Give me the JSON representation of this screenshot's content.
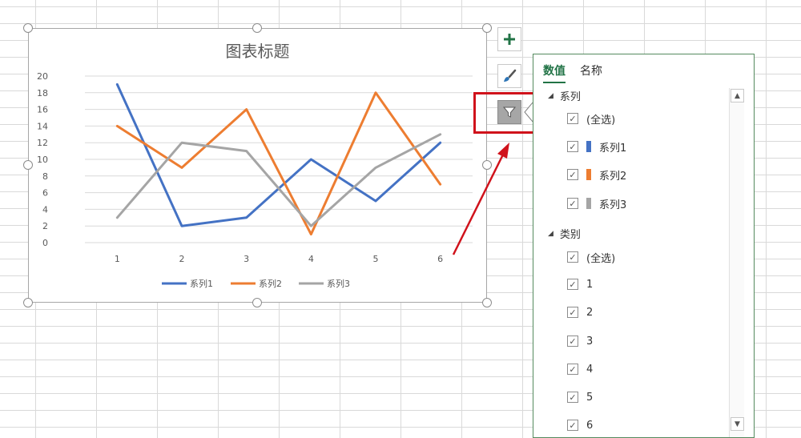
{
  "chart": {
    "title": "图表标题"
  },
  "chart_data": {
    "type": "line",
    "title": "图表标题",
    "categories": [
      "1",
      "2",
      "3",
      "4",
      "5",
      "6"
    ],
    "ylim": [
      0,
      20
    ],
    "yticks": [
      "0",
      "2",
      "4",
      "6",
      "8",
      "10",
      "12",
      "14",
      "16",
      "18",
      "20"
    ],
    "grid": true,
    "legend": "bottom",
    "series": [
      {
        "name": "系列1",
        "color": "#4472c4",
        "values": [
          19,
          2,
          3,
          10,
          5,
          12
        ]
      },
      {
        "name": "系列2",
        "color": "#ed7d31",
        "values": [
          14,
          9,
          16,
          1,
          18,
          7
        ]
      },
      {
        "name": "系列3",
        "color": "#a5a5a5",
        "values": [
          3,
          12,
          11,
          2,
          9,
          13
        ]
      }
    ]
  },
  "tools": {
    "add_icon": "plus-icon",
    "style_icon": "paintbrush-icon",
    "filter_icon": "funnel-icon"
  },
  "panel": {
    "tabs": [
      "数值",
      "名称"
    ],
    "series_group": {
      "label": "系列",
      "select_all": "(全选)",
      "items": [
        {
          "label": "系列1",
          "color": "#4472c4"
        },
        {
          "label": "系列2",
          "color": "#ed7d31"
        },
        {
          "label": "系列3",
          "color": "#a5a5a5"
        }
      ]
    },
    "category_group": {
      "label": "类别",
      "select_all": "(全选)",
      "items": [
        "1",
        "2",
        "3",
        "4",
        "5",
        "6"
      ]
    }
  }
}
